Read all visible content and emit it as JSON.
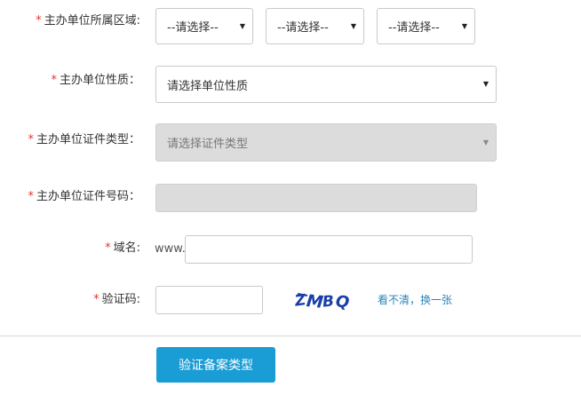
{
  "form": {
    "region": {
      "label": "主办单位所属区域:",
      "required_mark": "*",
      "province": "--请选择--",
      "city": "--请选择--",
      "district": "--请选择--"
    },
    "org_type": {
      "label": "主办单位性质：",
      "required_mark": "*",
      "value": "请选择单位性质"
    },
    "cert_type": {
      "label": "主办单位证件类型：",
      "required_mark": "*",
      "value": "请选择证件类型",
      "disabled": true
    },
    "cert_number": {
      "label": "主办单位证件号码：",
      "required_mark": "*",
      "value": "",
      "disabled": true
    },
    "domain": {
      "label": "域名:",
      "required_mark": "*",
      "prefix": "www.",
      "value": ""
    },
    "captcha": {
      "label": "验证码:",
      "required_mark": "*",
      "value": "",
      "image_text": "ZMBQ",
      "refresh_link": "看不清，换一张"
    }
  },
  "submit_button": "验证备案类型",
  "colors": {
    "required": "#e2362a",
    "button": "#1a9cd4",
    "link": "#2a86b8",
    "captcha_text": "#1b3fa8"
  },
  "icons": {
    "select_arrow": "caret-down-icon"
  }
}
